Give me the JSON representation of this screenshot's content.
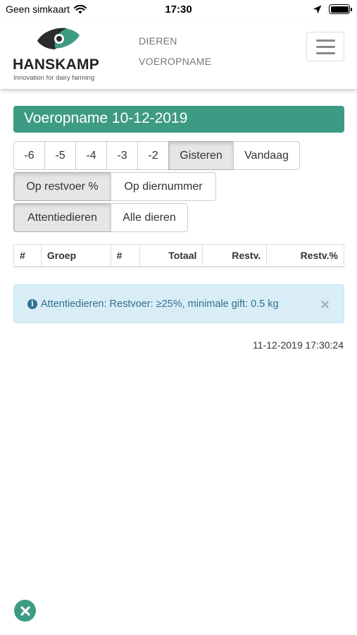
{
  "status_bar": {
    "carrier": "Geen simkaart",
    "time": "17:30"
  },
  "header": {
    "logo_name": "HANSKAMP",
    "logo_tagline": "Innovation for dairy farming",
    "nav": [
      {
        "label": "DIEREN"
      },
      {
        "label": "VOEROPNAME"
      }
    ]
  },
  "page": {
    "title": "Voeropname 10-12-2019",
    "day_buttons": [
      {
        "label": "-6",
        "active": false
      },
      {
        "label": "-5",
        "active": false
      },
      {
        "label": "-4",
        "active": false
      },
      {
        "label": "-3",
        "active": false
      },
      {
        "label": "-2",
        "active": false
      },
      {
        "label": "Gisteren",
        "active": true
      },
      {
        "label": "Vandaag",
        "active": false
      }
    ],
    "sort_buttons": [
      {
        "label": "Op restvoer %",
        "active": true
      },
      {
        "label": "Op diernummer",
        "active": false
      }
    ],
    "filter_buttons": [
      {
        "label": "Attentiedieren",
        "active": true
      },
      {
        "label": "Alle dieren",
        "active": false
      }
    ],
    "table_headers": [
      "#",
      "Groep",
      "#",
      "Totaal",
      "Restv.",
      "Restv.%"
    ],
    "alert_text": "Attentiedieren: Restvoer: ≥25%, minimale gift: 0.5 kg",
    "alert_close": "×",
    "timestamp": "11-12-2019 17:30:24"
  },
  "colors": {
    "brand": "#3d9b84",
    "alert_bg": "#d9edf7",
    "alert_text": "#31708f"
  },
  "icons": {
    "wifi": "wifi-icon",
    "location": "location-arrow-icon",
    "battery": "battery-icon",
    "menu": "hamburger-menu-icon",
    "info": "info-circle-icon",
    "close": "close-icon",
    "exit": "close-circle-icon"
  }
}
